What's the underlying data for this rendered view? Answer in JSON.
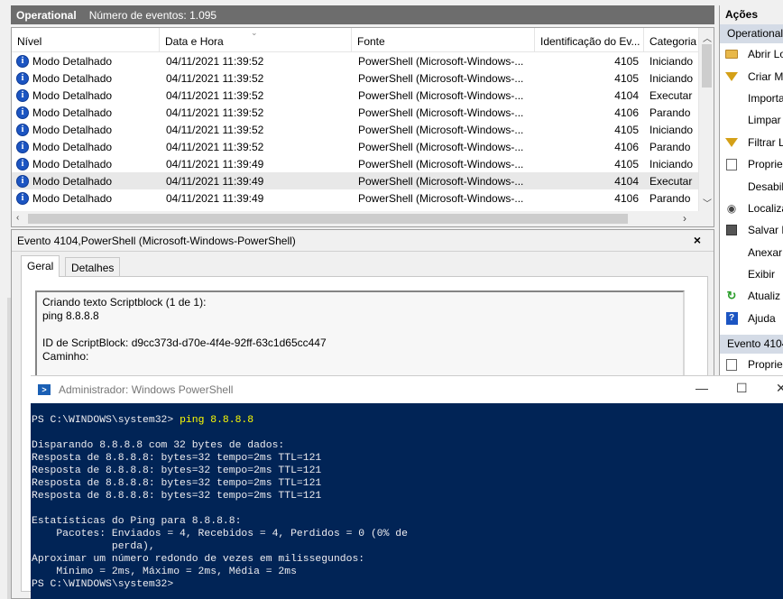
{
  "log": {
    "name": "Operational",
    "event_count_label": "Número de eventos: 1.095",
    "columns": [
      "Nível",
      "Data e Hora",
      "Fonte",
      "Identificação do Ev...",
      "Categoria"
    ],
    "rows": [
      {
        "level": "Modo Detalhado",
        "datetime": "04/11/2021 11:39:52",
        "source": "PowerShell (Microsoft-Windows-...",
        "id": "4105",
        "category": "Iniciando"
      },
      {
        "level": "Modo Detalhado",
        "datetime": "04/11/2021 11:39:52",
        "source": "PowerShell (Microsoft-Windows-...",
        "id": "4105",
        "category": "Iniciando"
      },
      {
        "level": "Modo Detalhado",
        "datetime": "04/11/2021 11:39:52",
        "source": "PowerShell (Microsoft-Windows-...",
        "id": "4104",
        "category": "Executar"
      },
      {
        "level": "Modo Detalhado",
        "datetime": "04/11/2021 11:39:52",
        "source": "PowerShell (Microsoft-Windows-...",
        "id": "4106",
        "category": "Parando"
      },
      {
        "level": "Modo Detalhado",
        "datetime": "04/11/2021 11:39:52",
        "source": "PowerShell (Microsoft-Windows-...",
        "id": "4105",
        "category": "Iniciando"
      },
      {
        "level": "Modo Detalhado",
        "datetime": "04/11/2021 11:39:52",
        "source": "PowerShell (Microsoft-Windows-...",
        "id": "4106",
        "category": "Parando"
      },
      {
        "level": "Modo Detalhado",
        "datetime": "04/11/2021 11:39:49",
        "source": "PowerShell (Microsoft-Windows-...",
        "id": "4105",
        "category": "Iniciando"
      },
      {
        "level": "Modo Detalhado",
        "datetime": "04/11/2021 11:39:49",
        "source": "PowerShell (Microsoft-Windows-...",
        "id": "4104",
        "category": "Executar"
      },
      {
        "level": "Modo Detalhado",
        "datetime": "04/11/2021 11:39:49",
        "source": "PowerShell (Microsoft-Windows-...",
        "id": "4106",
        "category": "Parando"
      }
    ],
    "selected_row_index": 7
  },
  "detail": {
    "title": "Evento 4104,PowerShell (Microsoft-Windows-PowerShell)",
    "close_glyph": "×",
    "tabs": [
      "Geral",
      "Detalhes"
    ],
    "text": "Criando texto Scriptblock (1 de 1):\nping 8.8.8.8\n\nID de ScriptBlock: d9cc373d-d70e-4f4e-92ff-63c1d65cc447\nCaminho:"
  },
  "actions": {
    "header": "Ações",
    "section1": "Operational",
    "items1": [
      {
        "label": "Abrir Lo",
        "icon": "folder-icon"
      },
      {
        "label": "Criar M",
        "icon": "filter-icon"
      },
      {
        "label": "Importa",
        "icon": ""
      },
      {
        "label": "Limpar",
        "icon": ""
      },
      {
        "label": "Filtrar L",
        "icon": "filter-icon"
      },
      {
        "label": "Proprie",
        "icon": "properties-icon"
      },
      {
        "label": "Desabil",
        "icon": ""
      },
      {
        "label": "Localiza",
        "icon": "binoculars-icon"
      },
      {
        "label": "Salvar E",
        "icon": "save-icon"
      },
      {
        "label": "Anexar",
        "icon": ""
      },
      {
        "label": "Exibir",
        "icon": ""
      },
      {
        "label": "Atualiz",
        "icon": "refresh-icon"
      },
      {
        "label": "Ajuda",
        "icon": "help-icon"
      }
    ],
    "section2": "Evento 4104",
    "items2": [
      {
        "label": "Proprie",
        "icon": "properties-icon"
      }
    ]
  },
  "powershell": {
    "title": "Administrador: Windows PowerShell",
    "minimize_glyph": "—",
    "maximize_glyph": "☐",
    "close_glyph": "✕",
    "prompt": "PS C:\\WINDOWS\\system32> ",
    "command": "ping 8.8.8.8",
    "output": "\nDisparando 8.8.8.8 com 32 bytes de dados:\nResposta de 8.8.8.8: bytes=32 tempo=2ms TTL=121\nResposta de 8.8.8.8: bytes=32 tempo=2ms TTL=121\nResposta de 8.8.8.8: bytes=32 tempo=2ms TTL=121\nResposta de 8.8.8.8: bytes=32 tempo=2ms TTL=121\n\nEstatísticas do Ping para 8.8.8.8:\n    Pacotes: Enviados = 4, Recebidos = 4, Perdidos = 0 (0% de\n             perda),\nAproximar um número redondo de vezes em milissegundos:\n    Mínimo = 2ms, Máximo = 2ms, Média = 2ms",
    "final_prompt": "PS C:\\WINDOWS\\system32>"
  }
}
